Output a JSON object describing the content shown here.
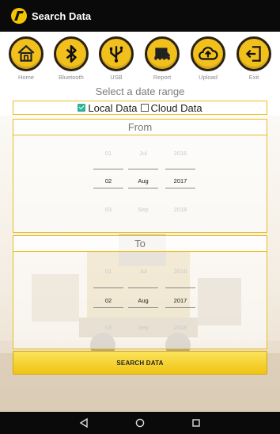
{
  "app": {
    "title": "Search Data"
  },
  "toolbar": [
    {
      "id": "home",
      "label": "Home",
      "icon": "home-icon"
    },
    {
      "id": "bluetooth",
      "label": "Bluetooth",
      "icon": "bluetooth-icon"
    },
    {
      "id": "usb",
      "label": "USB",
      "icon": "usb-icon"
    },
    {
      "id": "report",
      "label": "Report",
      "icon": "report-icon"
    },
    {
      "id": "upload",
      "label": "Upload",
      "icon": "upload-cloud-icon"
    },
    {
      "id": "exit",
      "label": "Exit",
      "icon": "exit-icon"
    }
  ],
  "heading": "Select a date range",
  "sources": {
    "local": {
      "label": "Local Data",
      "checked": true
    },
    "cloud": {
      "label": "Cloud Data",
      "checked": false
    }
  },
  "from": {
    "label": "From",
    "day": {
      "prev": "01",
      "value": "02",
      "next": "03"
    },
    "month": {
      "prev": "Jul",
      "value": "Aug",
      "next": "Sep"
    },
    "year": {
      "prev": "2016",
      "value": "2017",
      "next": "2018"
    }
  },
  "to": {
    "label": "To",
    "day": {
      "prev": "01",
      "value": "02",
      "next": "03"
    },
    "month": {
      "prev": "Jul",
      "value": "Aug",
      "next": "Sep"
    },
    "year": {
      "prev": "2016",
      "value": "2017",
      "next": "2018"
    }
  },
  "search_button": "SEARCH DATA",
  "nav": {
    "back": "back-icon",
    "home": "home-circle-icon",
    "recents": "recents-icon"
  },
  "colors": {
    "accent": "#F2C01C",
    "titlebar": "#0A0A0A",
    "check": "#2EB39A"
  }
}
